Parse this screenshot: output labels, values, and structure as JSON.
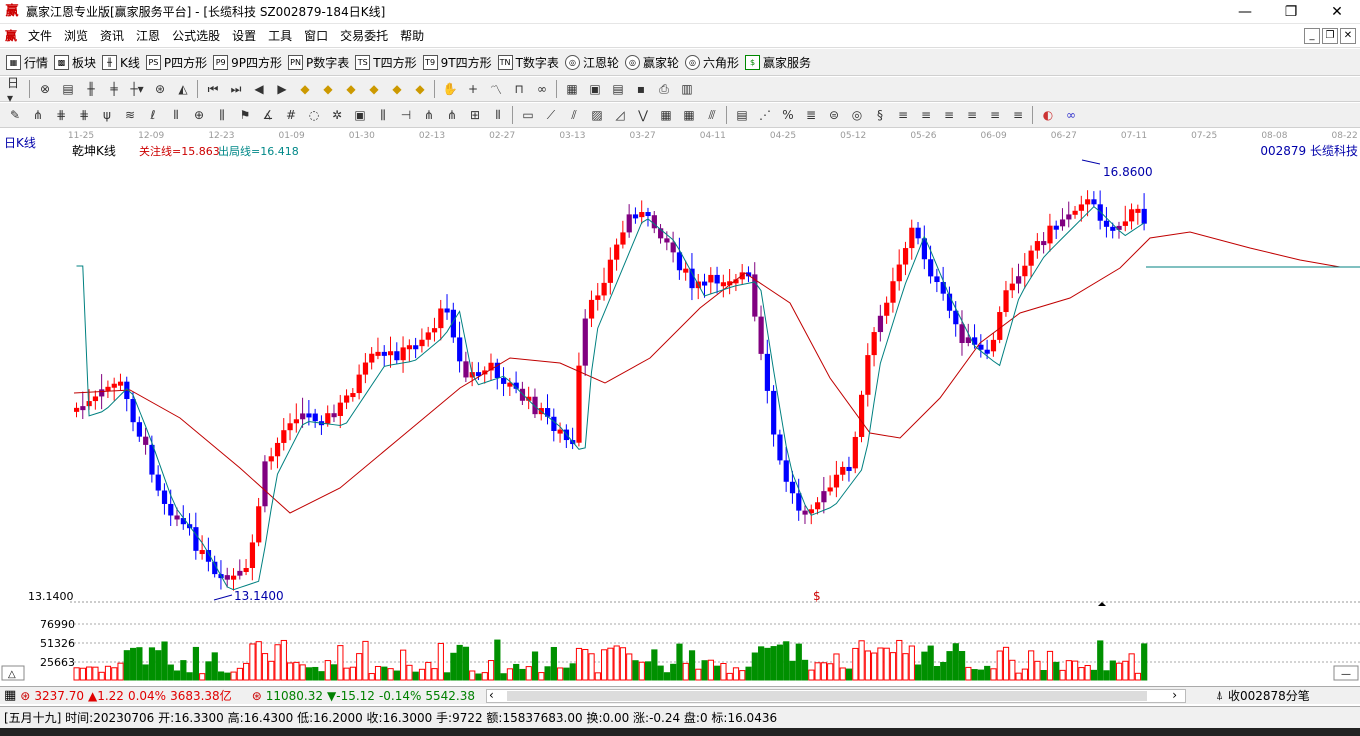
{
  "window": {
    "logo": "赢",
    "title": "赢家江恩专业版[赢家服务平台] - [长缆科技  SZ002879-184日K线]",
    "minimize": "—",
    "restore": "❐",
    "close": "✕"
  },
  "menu": {
    "logo": "赢",
    "items": [
      "文件",
      "浏览",
      "资讯",
      "江恩",
      "公式选股",
      "设置",
      "工具",
      "窗口",
      "交易委托",
      "帮助"
    ]
  },
  "toolbar1": {
    "items": [
      {
        "icon": "grid-icon",
        "glyph": "▦",
        "label": "行情"
      },
      {
        "icon": "blocks-icon",
        "glyph": "▩",
        "label": "板块"
      },
      {
        "icon": "kline-icon",
        "glyph": "╫",
        "label": "K线"
      },
      {
        "icon": "p-square-icon",
        "glyph": "PS",
        "label": "P四方形"
      },
      {
        "icon": "9p-square-icon",
        "glyph": "P9",
        "label": "9P四方形"
      },
      {
        "icon": "p-number-icon",
        "glyph": "PN",
        "label": "P数字表"
      },
      {
        "icon": "t-square-icon",
        "glyph": "TS",
        "label": "T四方形"
      },
      {
        "icon": "9t-square-icon",
        "glyph": "T9",
        "label": "9T四方形"
      },
      {
        "icon": "t-number-icon",
        "glyph": "TN",
        "label": "T数字表"
      },
      {
        "icon": "gann-wheel-icon",
        "glyph": "◎",
        "label": "江恩轮"
      },
      {
        "icon": "winner-wheel-icon",
        "glyph": "◎",
        "label": "赢家轮"
      },
      {
        "icon": "hexagon-icon",
        "glyph": "◎",
        "label": "六角形"
      },
      {
        "icon": "dollar-icon",
        "glyph": "$",
        "label": "赢家服务"
      }
    ]
  },
  "header": {
    "period": "日K线",
    "indicator": "乾坤K线",
    "focus_line": "关注线=15.863",
    "exit_line": "出局线=16.418",
    "stock": "002879  长缆科技",
    "high_label": "16.8600",
    "low_label": "13.1400",
    "axis_value": "13.1400",
    "dollar_mark": "$"
  },
  "dates": [
    "11-25",
    "12-09",
    "12-23",
    "01-09",
    "01-30",
    "02-13",
    "02-27",
    "03-13",
    "03-27",
    "04-11",
    "04-25",
    "05-12",
    "05-26",
    "06-09",
    "06-27",
    "07-11",
    "07-25",
    "08-08",
    "08-22"
  ],
  "volume_axis": [
    "76990",
    "51326",
    "25663"
  ],
  "colors": {
    "up": "#ff0000",
    "down": "#0000ff",
    "turn": "#800080",
    "ma_fast": "#008080",
    "ma_slow": "#c00000",
    "vol_up": "#ff0000",
    "vol_down": "#009000"
  },
  "status1": {
    "sh_index": "3237.70",
    "sh_change": "▲1.22",
    "sh_pct": "0.04%",
    "sh_amount": "3683.38亿",
    "sz_index": "11080.32",
    "sz_change": "▼-15.12",
    "sz_pct": "-0.14%",
    "sz_amount": "5542.38",
    "right_text": "收002878分笔"
  },
  "status2": {
    "text": "[五月十九] 时间:20230706 开:16.3300 高:16.4300 低:16.2000 收:16.3000 手:9722 额:15837683.00 换:0.00 涨:-0.24 盘:0 标:16.0436"
  },
  "chart_data": {
    "type": "candlestick",
    "price_range": [
      13.14,
      16.86
    ],
    "high": 16.86,
    "low": 13.14,
    "focus_line": 15.863,
    "exit_line": 16.418
  }
}
